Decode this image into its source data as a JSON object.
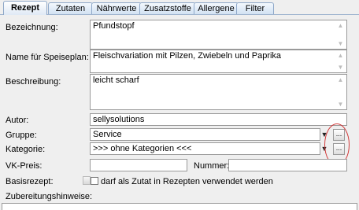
{
  "tabs": [
    {
      "label": "Rezept",
      "active": true
    },
    {
      "label": "Zutaten",
      "active": false
    },
    {
      "label": "Nährwerte",
      "active": false
    },
    {
      "label": "Zusatzstoffe",
      "active": false
    },
    {
      "label": "Allergene",
      "active": false
    },
    {
      "label": "Filter",
      "active": false
    }
  ],
  "form": {
    "bezeichnung": {
      "label": "Bezeichnung:",
      "value": "Pfundstopf"
    },
    "speiseplan": {
      "label": "Name für Speiseplan:",
      "value": "Fleischvariation mit Pilzen, Zwiebeln und Paprika"
    },
    "beschreibung": {
      "label": "Beschreibung:",
      "value": "leicht scharf"
    },
    "autor": {
      "label": "Autor:",
      "value": "sellysolutions"
    },
    "gruppe": {
      "label": "Gruppe:",
      "value": "Service",
      "button": "..."
    },
    "kategorie": {
      "label": "Kategorie:",
      "value": ">>> ohne Kategorien <<<",
      "button": "..."
    },
    "vkpreis": {
      "label": "VK-Preis:",
      "value": ""
    },
    "nummer": {
      "label": "Nummer:",
      "value": ""
    },
    "basisrezept": {
      "label": "Basisrezept:",
      "checkbox_label": "darf als Zutat in Rezepten verwendet werden",
      "checked": false
    },
    "zubereitung": {
      "label": "Zubereitungshinweise:"
    }
  },
  "colors": {
    "annotation": "#d23a3a",
    "tab_border": "#8fa8c8"
  }
}
